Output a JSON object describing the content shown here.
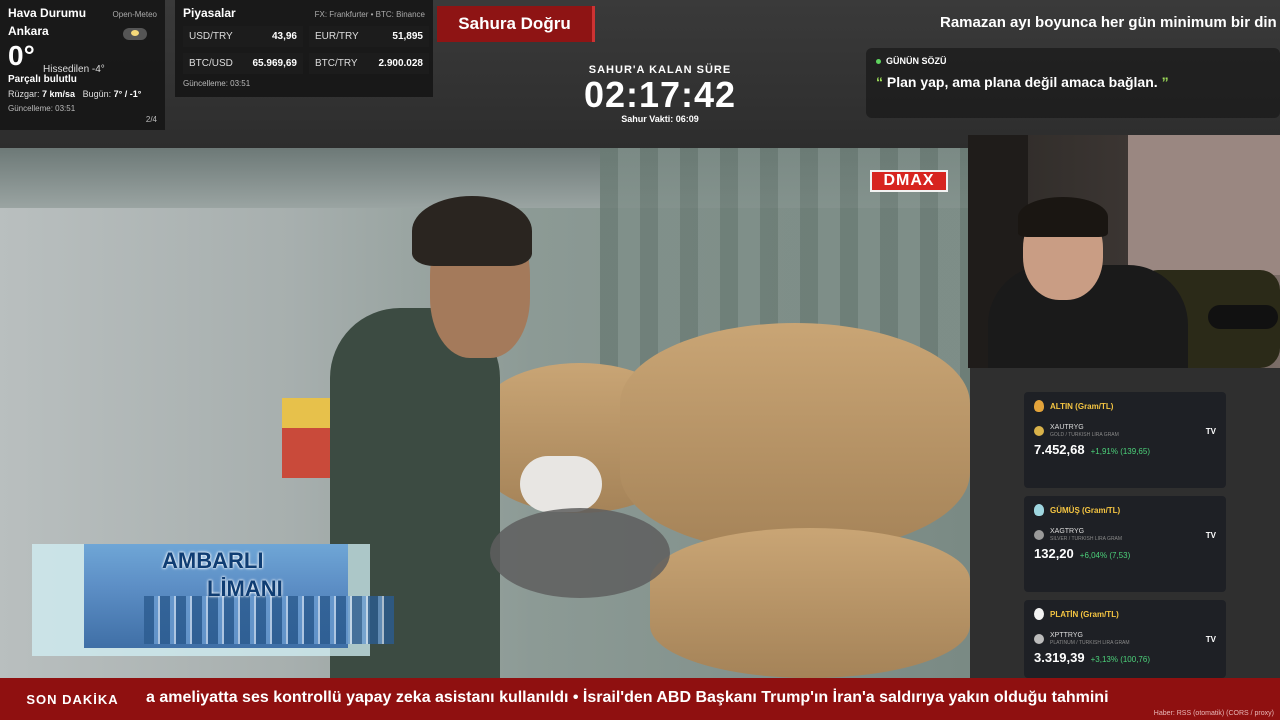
{
  "weather": {
    "title": "Hava Durumu",
    "source": "Open-Meteo",
    "city": "Ankara",
    "temp": "0°",
    "feels": "Hissedilen -4°",
    "condition": "Parçalı bulutlu",
    "wind_label": "Rüzgar:",
    "wind_value": "7 km/sa",
    "today_label": "Bugün:",
    "today_value": "7° / -1°",
    "updated": "Güncelleme: 03:51",
    "page": "2/4"
  },
  "markets": {
    "title": "Piyasalar",
    "source": "FX: Frankfurter • BTC: Binance",
    "items": [
      {
        "pair": "USD/TRY",
        "value": "43,96"
      },
      {
        "pair": "EUR/TRY",
        "value": "51,895"
      },
      {
        "pair": "BTC/USD",
        "value": "65.969,69"
      },
      {
        "pair": "BTC/TRY",
        "value": "2.900.028"
      }
    ],
    "updated": "Güncelleme: 03:51"
  },
  "sahur_title": "Sahura Doğru",
  "top_message": "Ramazan ayı boyunca her gün minimum bir din",
  "countdown": {
    "label": "SAHUR'A KALAN SÜRE",
    "time": "02:17:42",
    "sub": "Sahur Vakti: 06:09"
  },
  "quote": {
    "heading": "GÜNÜN SÖZÜ",
    "open_mark": "“",
    "text": "Plan yap, ama plana değil amaca bağlan.",
    "close_mark": "”"
  },
  "video": {
    "channel_logo": "DMAX",
    "inset_line1": "AMBARLI",
    "inset_line2": "LİMANI"
  },
  "metals": [
    {
      "title": "ALTIN (Gram/TL)",
      "symbol": "XAUTRYG",
      "desc": "GOLD / TURKISH LIRA GRAM",
      "price": "7.452,68",
      "change": "+1,91% (139,65)",
      "medal_color": "#e3a33a",
      "coin_color": "#d9b24a"
    },
    {
      "title": "GÜMÜŞ (Gram/TL)",
      "symbol": "XAGTRYG",
      "desc": "SILVER / TURKISH LIRA GRAM",
      "price": "132,20",
      "change": "+6,04% (7,53)",
      "medal_color": "#9fd6e0",
      "coin_color": "#9a9a9a"
    },
    {
      "title": "PLATİN (Gram/TL)",
      "symbol": "XPTTRYG",
      "desc": "PLATINUM / TURKISH LIRA GRAM",
      "price": "3.319,39",
      "change": "+3,13% (100,76)",
      "medal_color": "#f2f2f2",
      "coin_color": "#bcbcbc"
    }
  ],
  "ticker": {
    "label": "SON DAKİKA",
    "text": "a ameliyatta ses kontrollü yapay zeka asistanı kullanıldı   •   İsrail'den ABD Başkanı Trump'ın İran'a saldırıya yakın olduğu tahmini",
    "source": "Haber: RSS (otomatik) (CORS / proxy)"
  },
  "colors": {
    "ticker_bg": "#8f1010",
    "accent_green": "#4cd17a",
    "quote_mark": "#9ede5a",
    "gold": "#f5c542"
  }
}
